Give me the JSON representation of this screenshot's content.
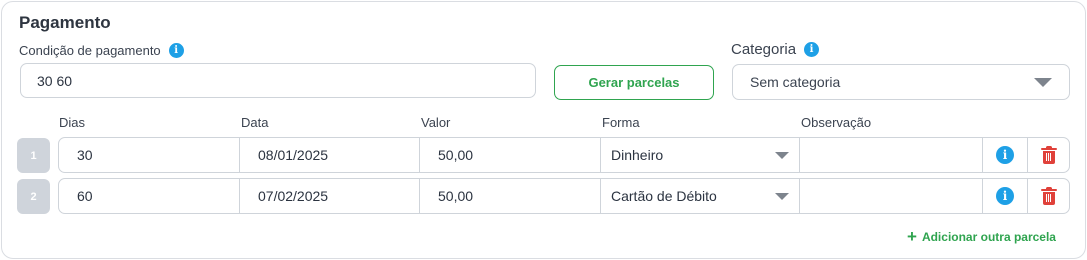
{
  "section": {
    "title": "Pagamento"
  },
  "payment_condition": {
    "label": "Condição de pagamento",
    "value": "30 60"
  },
  "generate_button": {
    "label": "Gerar parcelas"
  },
  "category": {
    "label": "Categoria",
    "selected": "Sem categoria"
  },
  "installments": {
    "headers": {
      "days": "Dias",
      "date": "Data",
      "value": "Valor",
      "method": "Forma",
      "notes": "Observação"
    },
    "rows": [
      {
        "number": "1",
        "days": "30",
        "date": "08/01/2025",
        "value": "50,00",
        "method": "Dinheiro",
        "notes": ""
      },
      {
        "number": "2",
        "days": "60",
        "date": "07/02/2025",
        "value": "50,00",
        "method": "Cartão de Débito",
        "notes": ""
      }
    ],
    "add_label": "Adicionar outra parcela"
  },
  "colors": {
    "accent_green": "#2fa44f",
    "info_blue": "#1ea0e6",
    "delete_red": "#e0413a"
  },
  "icons": {
    "info": "info-icon",
    "delete": "trash-icon",
    "dropdown": "chevron-down-icon",
    "add": "plus-icon"
  }
}
